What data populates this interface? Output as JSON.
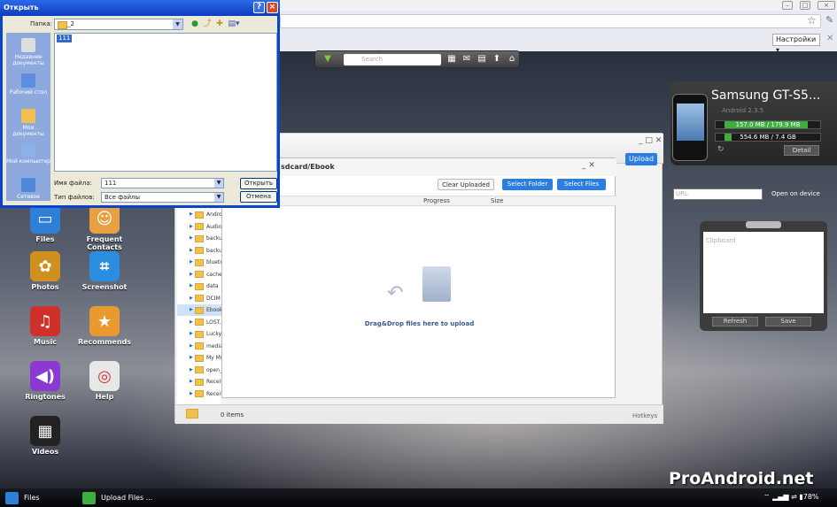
{
  "browser": {
    "settings_label": "Настройки ▾"
  },
  "toolbar": {
    "search_placeholder": "Search"
  },
  "device": {
    "name": "Samsung GT-S5...",
    "version": "Android 2.3.5",
    "storage1": "157.0 MB / 179.9 MB",
    "storage1_fraction": 0.87,
    "storage2": "554.6 MB / 7.4 GB",
    "storage2_fraction": 0.07,
    "detail_label": "Detail",
    "url_placeholder": "URL",
    "open_on_device": "Open on device"
  },
  "clipboard": {
    "title": "Clipboard",
    "refresh_label": "Refresh",
    "save_label": "Save"
  },
  "desktop_icons": [
    {
      "label": "Files",
      "icon": "folder-icon",
      "color": "#2f7fd8"
    },
    {
      "label": "Frequent Contacts",
      "icon": "contacts-icon",
      "color": "#e8a040"
    },
    {
      "label": "Photos",
      "icon": "photos-icon",
      "color": "#d09020"
    },
    {
      "label": "Screenshot",
      "icon": "crop-icon",
      "color": "#2a8ee0"
    },
    {
      "label": "Music",
      "icon": "music-icon",
      "color": "#d0302a"
    },
    {
      "label": "Recommends",
      "icon": "shop-icon",
      "color": "#e89a30"
    },
    {
      "label": "Ringtones",
      "icon": "speaker-icon",
      "color": "#8a3ad0"
    },
    {
      "label": "Help",
      "icon": "lifebuoy-icon",
      "color": "#e8e8e8"
    },
    {
      "label": "Videos",
      "icon": "clapper-icon",
      "color": "#222222"
    }
  ],
  "filemanager": {
    "upload_label": "Upload",
    "tree": [
      "Androi",
      "Audio",
      "backup",
      "backup",
      "bluetoo",
      "cache",
      "data",
      "DCIM",
      "Ebook",
      "LOST.D",
      "LuckyP",
      "media",
      "My Mu",
      "open_s",
      "Receiv",
      "Receiv"
    ],
    "selected": "Ebook",
    "items_count": "0 items",
    "hotkeys": "Hotkeys"
  },
  "upload": {
    "path": "sdcard/Ebook",
    "clear_label": "Clear Uploaded",
    "select_folder_label": "Select Folder",
    "select_files_label": "Select Files",
    "col_progress": "Progress",
    "col_size": "Size",
    "drop_message": "Drag&Drop files here to upload"
  },
  "open_dialog": {
    "title": "Открыть",
    "folder_label": "Папка:",
    "folder_value": "_2",
    "places": [
      "Недавние документы",
      "Рабочий стол",
      "Мои документы",
      "Мой компьютер",
      "Сетевое"
    ],
    "file_item": "111",
    "filename_label": "Имя файла:",
    "filename_value": "111",
    "filetype_label": "Тип файлов:",
    "filetype_value": "Все файлы",
    "open_label": "Открыть",
    "cancel_label": "Отмена"
  },
  "taskbar": {
    "files_label": "Files",
    "upload_label": "Upload Files ...",
    "battery": "78%"
  },
  "watermark": "ProAndroid.net"
}
